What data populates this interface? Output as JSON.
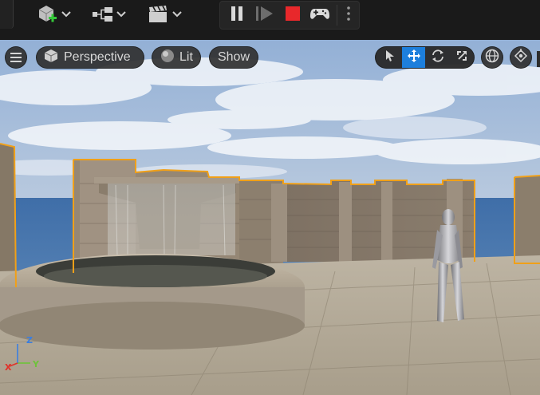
{
  "toolbar": {
    "add_icon": "cube-plus-icon",
    "blueprint_icon": "blueprint-nodes-icon",
    "cinematics_icon": "clapperboard-icon",
    "play_controls": {
      "pause_icon": "pause-icon",
      "advance_icon": "frame-advance-icon",
      "stop_icon": "stop-icon",
      "possess_icon": "gamepad-icon",
      "more_icon": "vertical-dots-icon",
      "stop_color": "#e8282b"
    }
  },
  "viewport": {
    "menu_icon": "hamburger-icon",
    "view_mode": "Perspective",
    "lighting_mode": "Lit",
    "show_label": "Show",
    "transform_tools": [
      "select-arrow-icon",
      "move-icon",
      "rotate-icon",
      "scale-icon"
    ],
    "active_tool": "move-icon",
    "coordinate_icon": "globe-icon",
    "snap_icon": "surface-snap-icon",
    "selection_color": "#f0a019",
    "axis_labels": [
      "X",
      "Y",
      "Z"
    ]
  }
}
